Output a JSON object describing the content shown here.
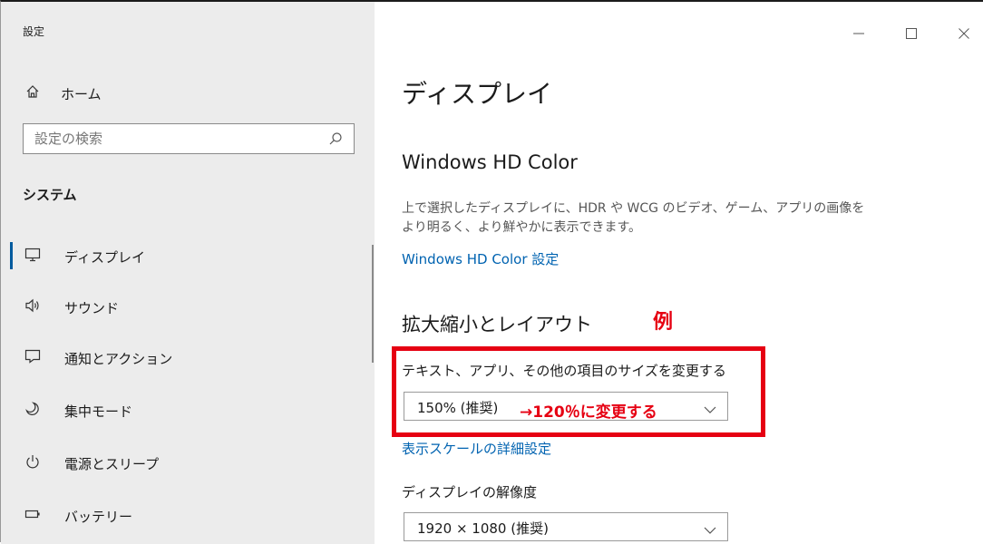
{
  "window": {
    "title": "設定",
    "controls": {
      "minimize": "—",
      "maximize": "☐",
      "close": "✕"
    }
  },
  "sidebar": {
    "home_label": "ホーム",
    "search_placeholder": "設定の検索",
    "section_label": "システム",
    "items": [
      {
        "label": "ディスプレイ",
        "icon": "monitor-icon",
        "selected": true
      },
      {
        "label": "サウンド",
        "icon": "speaker-icon"
      },
      {
        "label": "通知とアクション",
        "icon": "notification-icon"
      },
      {
        "label": "集中モード",
        "icon": "moon-icon"
      },
      {
        "label": "電源とスリープ",
        "icon": "power-icon"
      },
      {
        "label": "バッテリー",
        "icon": "battery-icon"
      }
    ]
  },
  "main": {
    "title": "ディスプレイ",
    "hd_color": {
      "heading": "Windows HD Color",
      "description_line1": "上で選択したディスプレイに、HDR や WCG のビデオ、ゲーム、アプリの画像を",
      "description_line2": "より明るく、より鮮やかに表示できます。",
      "link": "Windows HD Color 設定"
    },
    "scale_layout": {
      "heading": "拡大縮小とレイアウト",
      "size_label": "テキスト、アプリ、その他の項目のサイズを変更する",
      "size_value": "150% (推奨)",
      "advanced_link": "表示スケールの詳細設定",
      "resolution_label": "ディスプレイの解像度",
      "resolution_value": "1920 × 1080 (推奨)"
    }
  },
  "annotation": {
    "example_label": "例",
    "change_note": "→120％に変更する",
    "color": "#e60012"
  },
  "colors": {
    "accent": "#0063b1",
    "sidebar_bg": "#ececec",
    "selected_indicator": "#005a9e"
  }
}
